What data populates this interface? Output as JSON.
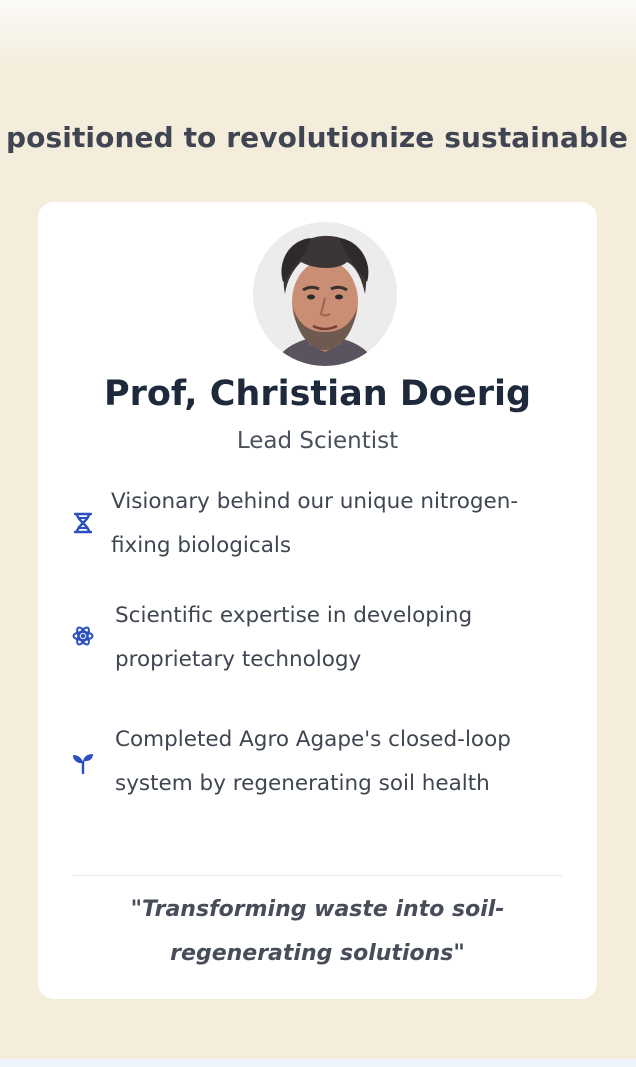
{
  "headline": "positioned to revolutionize sustainable agric",
  "profile": {
    "name": "Prof, Christian Doerig",
    "role": "Lead Scientist",
    "photo_alt": "portrait photo"
  },
  "features": [
    {
      "icon": "dna-icon",
      "text": "Visionary behind our unique nitrogen-fixing biologicals"
    },
    {
      "icon": "atom-icon",
      "text": "Scientific expertise in developing proprietary technology"
    },
    {
      "icon": "seedling-icon",
      "text": "Completed Agro Agape's closed-loop system by regenerating soil health"
    }
  ],
  "quote": "\"Transforming waste into soil-regenerating solutions\"",
  "colors": {
    "background": "#f4eddc",
    "card": "#ffffff",
    "icon_blue": "#2b4fbf",
    "heading": "#1e2a3b"
  }
}
